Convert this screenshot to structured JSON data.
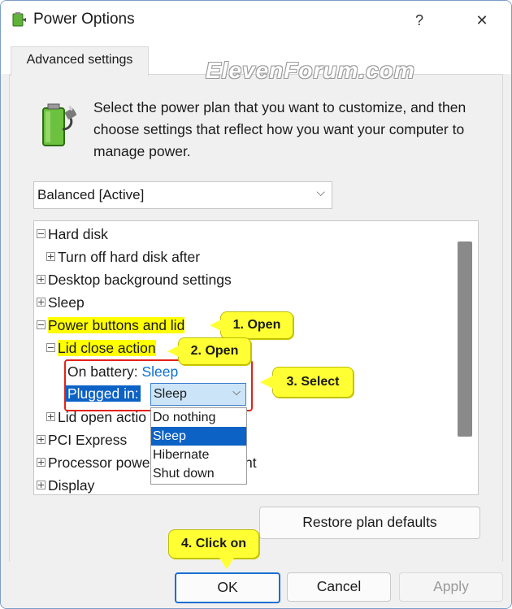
{
  "window": {
    "title": "Power Options",
    "help_label": "?",
    "close_label": "✕",
    "app_icon": "power-options-icon"
  },
  "tabs": [
    {
      "label": "Advanced settings"
    }
  ],
  "watermark": "ElevenForum.com",
  "header": {
    "icon": "battery-plug-icon",
    "description": "Select the power plan that you want to customize, and then choose settings that reflect how you want your computer to manage power."
  },
  "plan_select": {
    "value": "Balanced [Active]"
  },
  "tree": {
    "hard_disk": "Hard disk",
    "turn_off_hard_disk": "Turn off hard disk after",
    "desktop_background": "Desktop background settings",
    "sleep": "Sleep",
    "power_buttons_lid": "Power buttons and lid",
    "lid_close_action": "Lid close action",
    "on_battery_label": "On battery:",
    "on_battery_value": "Sleep",
    "plugged_in_label": "Plugged in:",
    "plugged_in_value": "Sleep",
    "lid_open_action": "Lid open actio",
    "pci_express": "PCI Express",
    "processor_power": "Processor powe",
    "processor_power_tail": "nt",
    "display": "Display"
  },
  "dropdown_options": [
    "Do nothing",
    "Sleep",
    "Hibernate",
    "Shut down"
  ],
  "selected_option": "Sleep",
  "buttons": {
    "restore": "Restore plan defaults",
    "ok": "OK",
    "cancel": "Cancel",
    "apply": "Apply"
  },
  "callouts": {
    "c1": "1. Open",
    "c2": "2. Open",
    "c3": "3. Select",
    "c4": "4. Click on"
  },
  "colors": {
    "highlight": "#ffff00",
    "selection": "#0c62c5",
    "link": "#0c6fd1",
    "annotation_red": "#e3231a",
    "callout": "#ffff33"
  }
}
